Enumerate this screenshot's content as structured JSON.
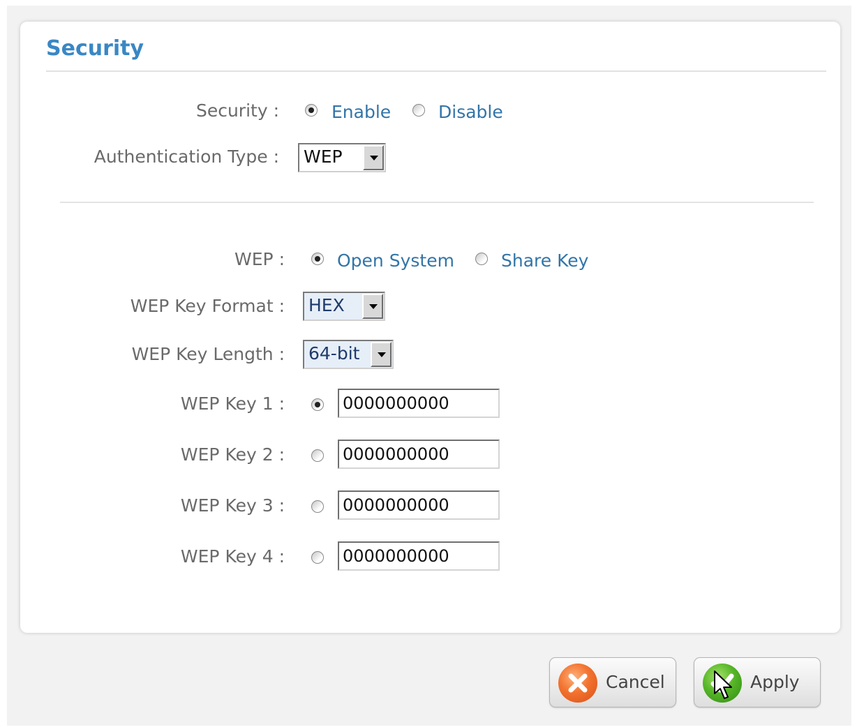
{
  "panel": {
    "title": "Security"
  },
  "security": {
    "label": "Security :",
    "options": [
      {
        "label": "Enable",
        "selected": true
      },
      {
        "label": "Disable",
        "selected": false
      }
    ]
  },
  "auth_type": {
    "label": "Authentication Type :",
    "value": "WEP"
  },
  "wep": {
    "label": "WEP :",
    "options": [
      {
        "label": "Open System",
        "selected": true
      },
      {
        "label": "Share Key",
        "selected": false
      }
    ]
  },
  "key_format": {
    "label": "WEP Key Format :",
    "value": "HEX"
  },
  "key_length": {
    "label": "WEP Key Length :",
    "value": "64-bit"
  },
  "keys": [
    {
      "label": "WEP Key 1 :",
      "value": "0000000000",
      "selected": true
    },
    {
      "label": "WEP Key 2 :",
      "value": "0000000000",
      "selected": false
    },
    {
      "label": "WEP Key 3 :",
      "value": "0000000000",
      "selected": false
    },
    {
      "label": "WEP Key 4 :",
      "value": "0000000000",
      "selected": false
    }
  ],
  "buttons": {
    "cancel": "Cancel",
    "apply": "Apply"
  },
  "colors": {
    "title": "#3a87c4",
    "option_text": "#3275a8",
    "label_text": "#6a6a6a"
  },
  "icons": {
    "cancel": "x-circle-icon",
    "apply": "check-circle-icon",
    "pointer": "mouse-pointer-icon"
  }
}
